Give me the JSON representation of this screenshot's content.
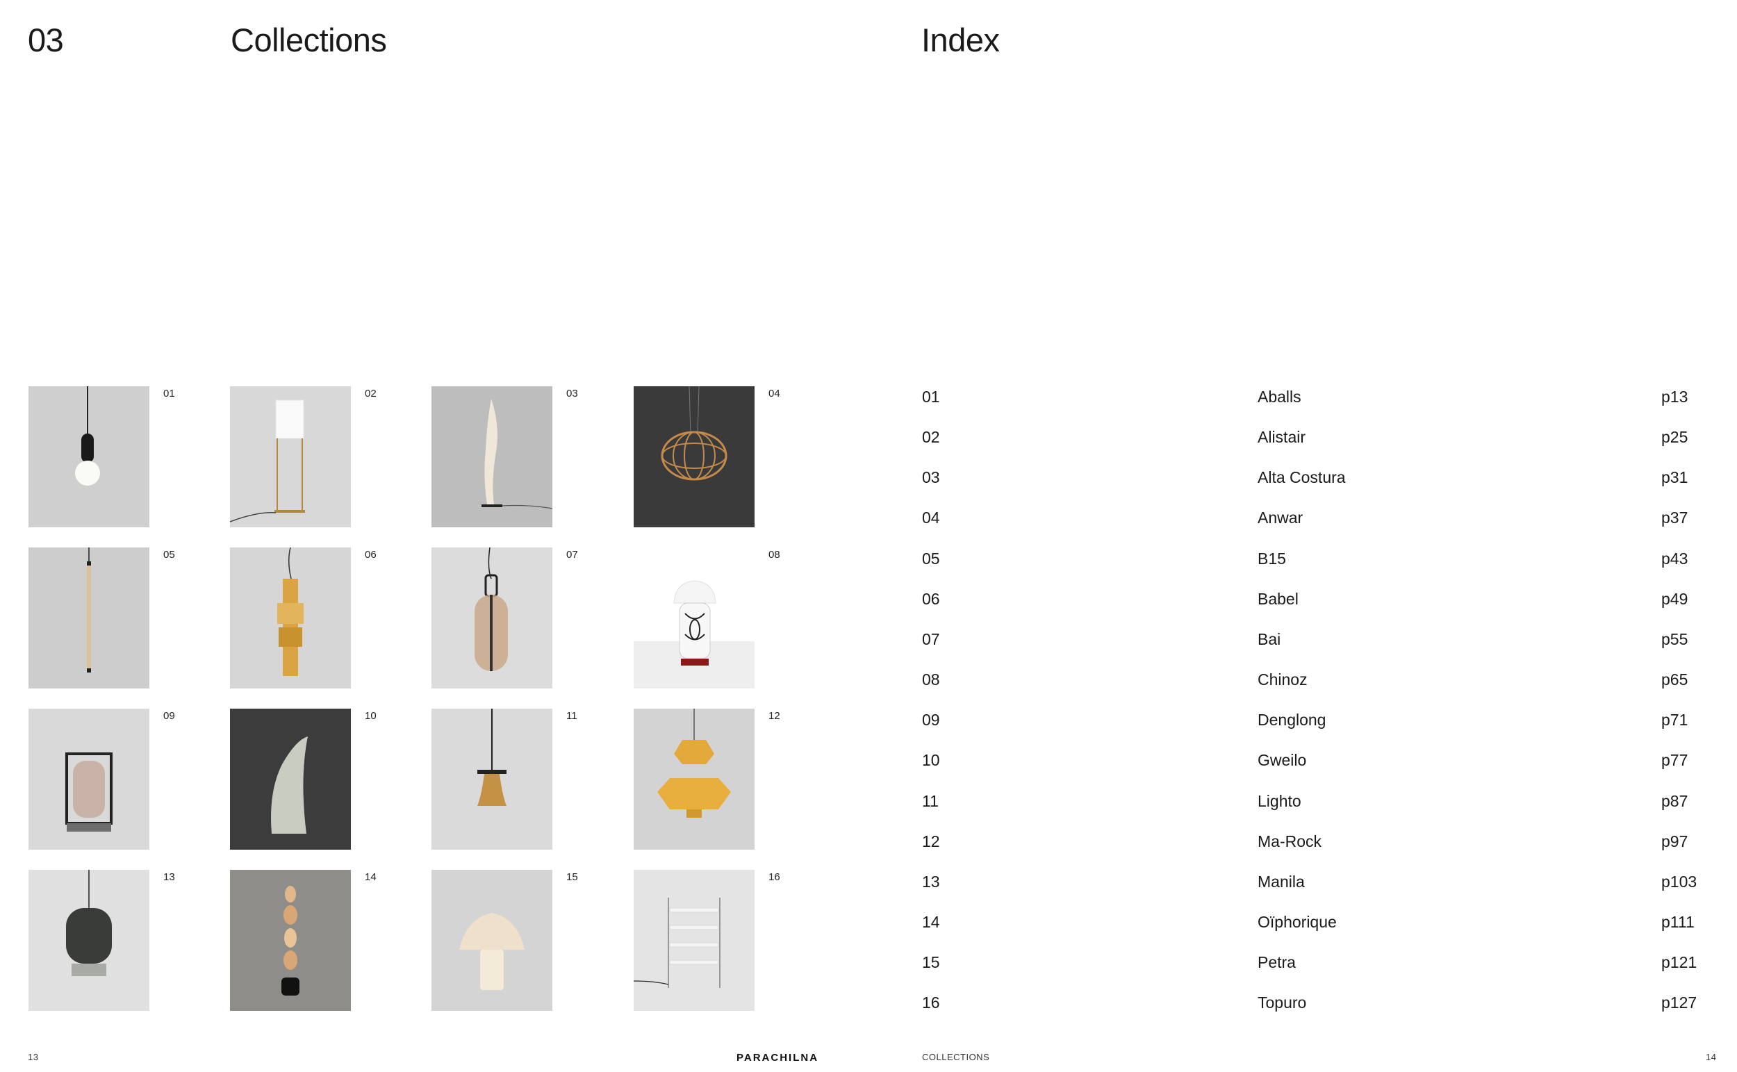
{
  "left_page": {
    "section_number": "03",
    "section_title": "Collections",
    "page_number": "13",
    "brand": "PARACHILNA"
  },
  "right_page": {
    "title": "Index",
    "footer_label": "COLLECTIONS",
    "page_number": "14"
  },
  "thumbnails": [
    {
      "number": "01",
      "name": "Aballs",
      "bg": "#cfcfcf"
    },
    {
      "number": "02",
      "name": "Alistair",
      "bg": "#d8d8d8"
    },
    {
      "number": "03",
      "name": "Alta Costura",
      "bg": "#bdbdbd"
    },
    {
      "number": "04",
      "name": "Anwar",
      "bg": "#3a3a3a"
    },
    {
      "number": "05",
      "name": "B15",
      "bg": "#cdcdcd"
    },
    {
      "number": "06",
      "name": "Babel",
      "bg": "#d6d6d6"
    },
    {
      "number": "07",
      "name": "Bai",
      "bg": "#dcdcdc"
    },
    {
      "number": "08",
      "name": "Chinoz",
      "bg": "#ffffff"
    },
    {
      "number": "09",
      "name": "Denglong",
      "bg": "#d9d9d9"
    },
    {
      "number": "10",
      "name": "Gweilo",
      "bg": "#3c3c3c"
    },
    {
      "number": "11",
      "name": "Lighto",
      "bg": "#dadada"
    },
    {
      "number": "12",
      "name": "Ma-Rock",
      "bg": "#d3d3d3"
    },
    {
      "number": "13",
      "name": "Manila",
      "bg": "#e0e0e0"
    },
    {
      "number": "14",
      "name": "Oïphorique",
      "bg": "#8f8d89"
    },
    {
      "number": "15",
      "name": "Petra",
      "bg": "#d4d4d4"
    },
    {
      "number": "16",
      "name": "Topuro",
      "bg": "#e4e4e4"
    }
  ],
  "index": [
    {
      "number": "01",
      "name": "Aballs",
      "page": "p13"
    },
    {
      "number": "02",
      "name": "Alistair",
      "page": "p25"
    },
    {
      "number": "03",
      "name": "Alta Costura",
      "page": "p31"
    },
    {
      "number": "04",
      "name": "Anwar",
      "page": "p37"
    },
    {
      "number": "05",
      "name": "B15",
      "page": "p43"
    },
    {
      "number": "06",
      "name": "Babel",
      "page": "p49"
    },
    {
      "number": "07",
      "name": "Bai",
      "page": "p55"
    },
    {
      "number": "08",
      "name": "Chinoz",
      "page": "p65"
    },
    {
      "number": "09",
      "name": "Denglong",
      "page": "p71"
    },
    {
      "number": "10",
      "name": "Gweilo",
      "page": "p77"
    },
    {
      "number": "11",
      "name": "Lighto",
      "page": "p87"
    },
    {
      "number": "12",
      "name": "Ma-Rock",
      "page": "p97"
    },
    {
      "number": "13",
      "name": "Manila",
      "page": "p103"
    },
    {
      "number": "14",
      "name": "Oïphorique",
      "page": "p111"
    },
    {
      "number": "15",
      "name": "Petra",
      "page": "p121"
    },
    {
      "number": "16",
      "name": "Topuro",
      "page": "p127"
    }
  ]
}
